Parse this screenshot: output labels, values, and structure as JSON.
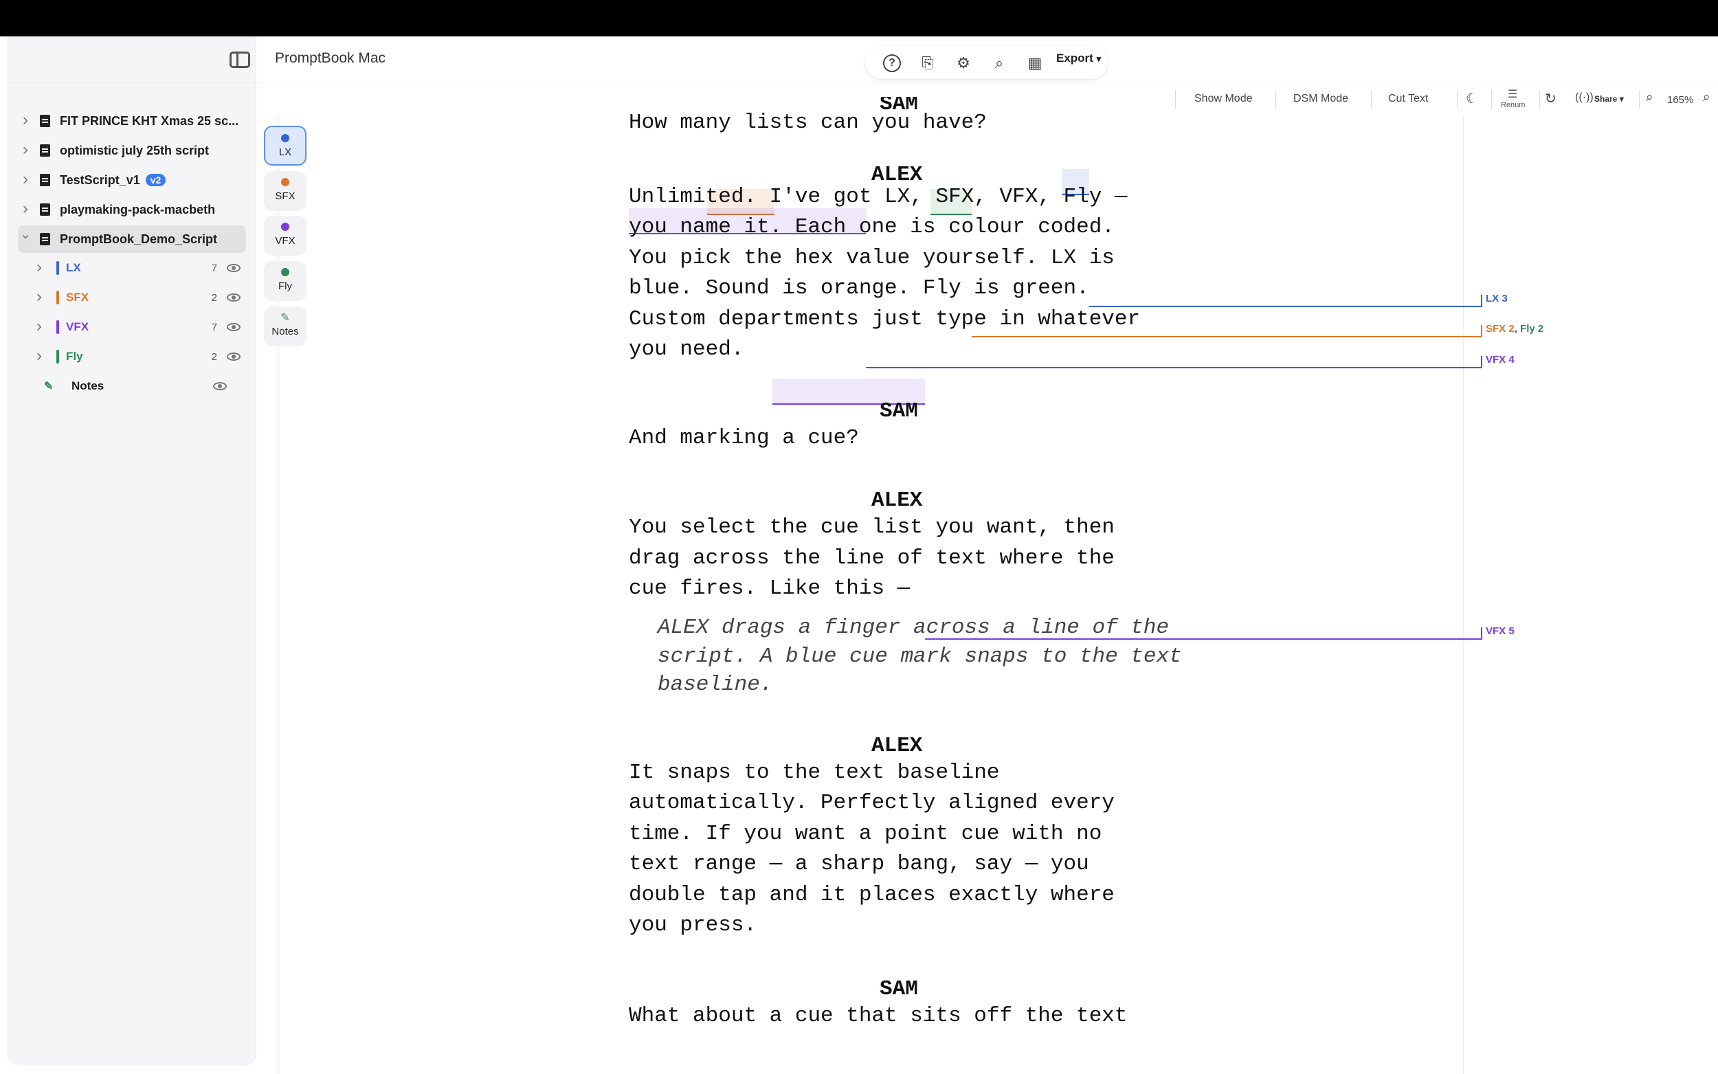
{
  "app": {
    "title": "PromptBook Mac"
  },
  "sidebar": {
    "scripts": [
      {
        "name": "FIT PRINCE KHT Xmas 25 sc...",
        "badge": ""
      },
      {
        "name": "optimistic july 25th script",
        "badge": ""
      },
      {
        "name": "TestScript_v1",
        "badge": "v2"
      },
      {
        "name": "playmaking-pack-macbeth",
        "badge": ""
      },
      {
        "name": "PromptBook_Demo_Script",
        "badge": ""
      }
    ],
    "departments": [
      {
        "name": "LX",
        "count": "7",
        "color": "#3563d9"
      },
      {
        "name": "SFX",
        "count": "2",
        "color": "#d9782a"
      },
      {
        "name": "VFX",
        "count": "7",
        "color": "#7a3de0"
      },
      {
        "name": "Fly",
        "count": "2",
        "color": "#2f8a55"
      }
    ],
    "notes_label": "Notes"
  },
  "toolbar": {
    "export_label": "Export",
    "show_mode": "Show Mode",
    "dsm_mode": "DSM Mode",
    "cut_text": "Cut Text",
    "renum": "Renum",
    "share": "Share",
    "zoom": "165%"
  },
  "rail": {
    "items": [
      {
        "label": "LX",
        "color": "#3563d9"
      },
      {
        "label": "SFX",
        "color": "#d9782a"
      },
      {
        "label": "VFX",
        "color": "#7a3de0"
      },
      {
        "label": "Fly",
        "color": "#2f8a55"
      },
      {
        "label": "Notes",
        "color": "#3a8a5a"
      }
    ]
  },
  "script": {
    "lines": [
      "SAM",
      "How many lists can you have?",
      "ALEX",
      "Unlimited. I've got LX, SFX, VFX, Fly —",
      "you name it. Each one is colour coded.",
      "You pick the hex value yourself. LX is",
      "blue. Sound is orange. Fly is green.",
      "Custom departments just type in whatever",
      "you need.",
      "SAM",
      "And marking a cue?",
      "ALEX",
      "You select the cue list you want, then",
      "drag across the line of text where the",
      "cue fires. Like this —",
      "ALEX drags a finger across a line of the",
      "script. A blue cue mark snaps to the text",
      "baseline.",
      "ALEX",
      "It snaps to the text baseline",
      "automatically. Perfectly aligned every",
      "time. If you want a point cue with no",
      "text range — a sharp bang, say — you",
      "double tap and it places exactly where",
      "you press.",
      "SAM",
      "What about a cue that sits off the text"
    ]
  },
  "cues": {
    "lx3": "LX 3",
    "sfx2": "SFX 2",
    "comma": ",",
    "fly2": "Fly 2",
    "vfx4": "VFX 4",
    "vfx5": "VFX 5"
  }
}
